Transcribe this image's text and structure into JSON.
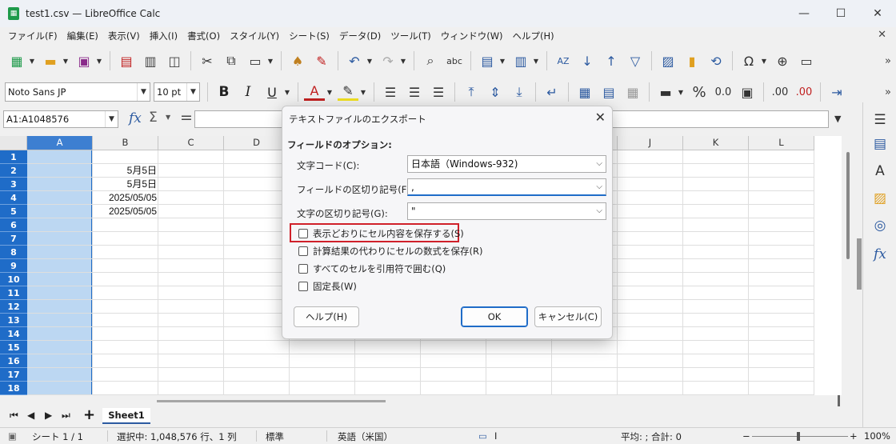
{
  "window": {
    "title": "test1.csv — LibreOffice Calc",
    "minimize": "—",
    "maximize": "☐",
    "close": "✕"
  },
  "menubar": {
    "items": [
      "ファイル(F)",
      "編集(E)",
      "表示(V)",
      "挿入(I)",
      "書式(O)",
      "スタイル(Y)",
      "シート(S)",
      "データ(D)",
      "ツール(T)",
      "ウィンドウ(W)",
      "ヘルプ(H)"
    ],
    "close": "✕"
  },
  "formatting": {
    "font_name": "Noto Sans JP",
    "font_size": "10 pt",
    "bold": "B",
    "italic": "I",
    "underline": "U",
    "percent": "%",
    "decimal": "0.0",
    "add_decimal": ".00",
    "remove_decimal": ".00"
  },
  "formula_bar": {
    "name_box": "A1:A1048576",
    "fx": "fx",
    "sigma": "Σ",
    "equals": "=",
    "content": ""
  },
  "grid": {
    "columns": [
      "A",
      "B",
      "C",
      "D",
      "E",
      "F",
      "G",
      "H",
      "I",
      "J",
      "K",
      "L"
    ],
    "selected_column": "A",
    "rows": [
      "1",
      "2",
      "3",
      "4",
      "5",
      "6",
      "7",
      "8",
      "9",
      "10",
      "11",
      "12",
      "13",
      "14",
      "15",
      "16",
      "17",
      "18"
    ],
    "cells": {
      "B2": "5月5日",
      "B3": "5月5日",
      "B4": "2025/05/05",
      "B5": "2025/05/05"
    }
  },
  "sheet_tabs": {
    "active": "Sheet1",
    "add": "+"
  },
  "statusbar": {
    "sheet": "シート 1 / 1",
    "selection": "選択中: 1,048,576 行、1 列",
    "style": "標準",
    "language": "英語（米国）",
    "sum": "平均: ; 合計: 0",
    "zoom": "100%"
  },
  "dialog": {
    "title": "テキストファイルのエクスポート",
    "section": "フィールドのオプション:",
    "charset_label": "文字コード(C):",
    "charset_value": "日本語（Windows-932)",
    "field_sep_label": "フィールドの区切り記号(F):",
    "field_sep_value": ",",
    "string_sep_label": "文字の区切り記号(G):",
    "string_sep_value": "\"",
    "options": [
      {
        "label": "表示どおりにセル内容を保存する(S)",
        "checked": false
      },
      {
        "label": "計算結果の代わりにセルの数式を保存(R)",
        "checked": false
      },
      {
        "label": "すべてのセルを引用符で囲む(Q)",
        "checked": false
      },
      {
        "label": "固定長(W)",
        "checked": false
      }
    ],
    "help_button": "ヘルプ(H)",
    "ok_button": "OK",
    "cancel_button": "キャンセル(C)",
    "close": "✕"
  }
}
